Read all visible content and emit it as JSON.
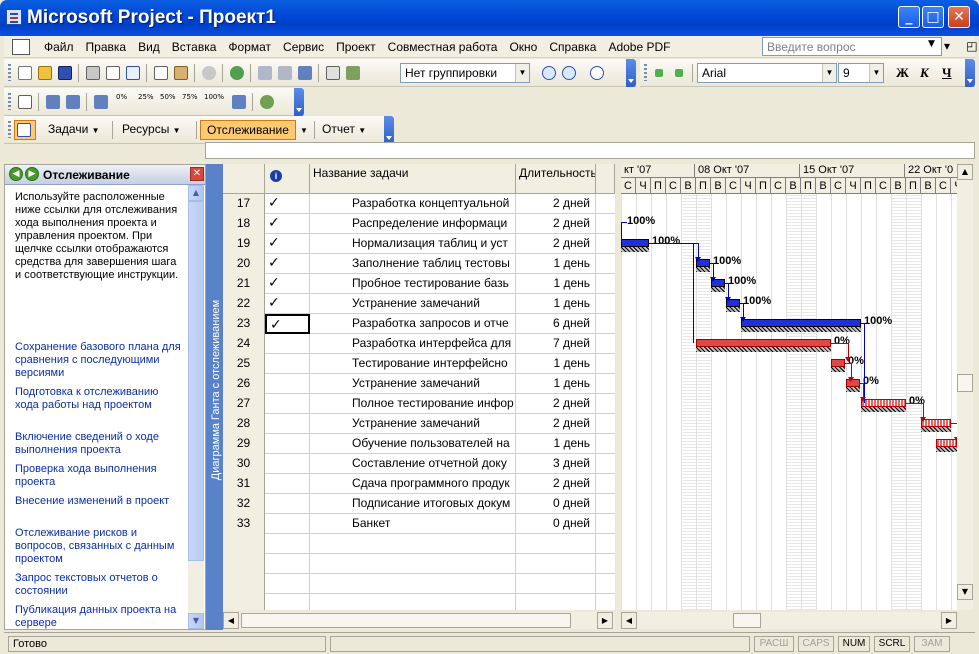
{
  "window": {
    "title": "Microsoft Project - Проект1"
  },
  "menu": {
    "items": [
      "Файл",
      "Правка",
      "Вид",
      "Вставка",
      "Формат",
      "Сервис",
      "Проект",
      "Совместная работа",
      "Окно",
      "Справка",
      "Adobe PDF"
    ],
    "ask_placeholder": "Введите вопрос"
  },
  "toolbar": {
    "grouping": "Нет группировки",
    "font": "Arial",
    "font_size": "9",
    "bold": "Ж",
    "italic": "К",
    "underline": "Ч",
    "percent_buttons": [
      "0%",
      "25%",
      "50%",
      "75%",
      "100%"
    ]
  },
  "guide": {
    "tasks": "Задачи",
    "resources": "Ресурсы",
    "tracking": "Отслеживание",
    "report": "Отчет"
  },
  "taskpane": {
    "title": "Отслеживание",
    "intro": "Используйте расположенные ниже ссылки для отслеживания хода выполнения проекта и управления проектом. При щелчке ссылки отображаются средства для завершения шага и соответствующие инструкции.",
    "links": [
      "Сохранение базового плана для сравнения с последующими версиями",
      "Подготовка к отслеживанию хода работы над проектом",
      "Включение сведений о ходе выполнения проекта",
      "Проверка хода выполнения проекта",
      "Внесение изменений в проект",
      "Отслеживание рисков и вопросов, связанных с данным проектом",
      "Запрос текстовых отчетов о состоянии",
      "Публикация данных проекта на сервере"
    ]
  },
  "view_bar": {
    "label": "Диаграмма Ганта с отслеживанием"
  },
  "table": {
    "headers": {
      "indicator": "i",
      "name": "Название задачи",
      "duration": "Длительность"
    },
    "rows": [
      {
        "id": "17",
        "done": "✓",
        "name": "Разработка концептуальной",
        "duration": "2 дней"
      },
      {
        "id": "18",
        "done": "✓",
        "name": "Распределение информаци",
        "duration": "2 дней"
      },
      {
        "id": "19",
        "done": "✓",
        "name": "Нормализация таблиц и уст",
        "duration": "2 дней"
      },
      {
        "id": "20",
        "done": "✓",
        "name": "Заполнение таблиц тестовы",
        "duration": "1 день"
      },
      {
        "id": "21",
        "done": "✓",
        "name": "Пробное тестирование базь",
        "duration": "1 день"
      },
      {
        "id": "22",
        "done": "✓",
        "name": "Устранение замечаний",
        "duration": "1 день"
      },
      {
        "id": "23",
        "done": "✓",
        "name": "Разработка запросов и отче",
        "duration": "6 дней"
      },
      {
        "id": "24",
        "done": "",
        "name": "Разработка интерфейса для",
        "duration": "7 дней"
      },
      {
        "id": "25",
        "done": "",
        "name": "Тестирование интерфейсно",
        "duration": "1 день"
      },
      {
        "id": "26",
        "done": "",
        "name": "Устранение замечаний",
        "duration": "1 день"
      },
      {
        "id": "27",
        "done": "",
        "name": "Полное тестирование инфор",
        "duration": "2 дней"
      },
      {
        "id": "28",
        "done": "",
        "name": "Устранение замечаний",
        "duration": "2 дней"
      },
      {
        "id": "29",
        "done": "",
        "name": "Обучение пользователей на",
        "duration": "1 день"
      },
      {
        "id": "30",
        "done": "",
        "name": "Составление отчетной доку",
        "duration": "3 дней"
      },
      {
        "id": "31",
        "done": "",
        "name": "Сдача программного продук",
        "duration": "2 дней"
      },
      {
        "id": "32",
        "done": "",
        "name": "Подписание итоговых докум",
        "duration": "0 дней"
      },
      {
        "id": "33",
        "done": "",
        "name": "Банкет",
        "duration": "0 дней"
      }
    ]
  },
  "gantt": {
    "weeks": [
      "кт '07",
      "08 Окт '07",
      "15 Окт '07",
      "22 Окт '0"
    ],
    "days": [
      "С",
      "Ч",
      "П",
      "С",
      "В",
      "П",
      "В",
      "С",
      "Ч",
      "П",
      "С",
      "В",
      "П",
      "В",
      "С",
      "Ч",
      "П",
      "С",
      "В",
      "П",
      "В",
      "С",
      "Ч",
      "П",
      "С",
      "В"
    ],
    "labels": [
      "100%",
      "100%",
      "100%",
      "100%",
      "100%",
      "100%",
      "0%",
      "0%",
      "0%",
      "0%"
    ]
  },
  "status": {
    "text": "Готово",
    "indicators": [
      "РАСШ",
      "CAPS",
      "NUM",
      "SCRL",
      "ЗАМ"
    ]
  }
}
